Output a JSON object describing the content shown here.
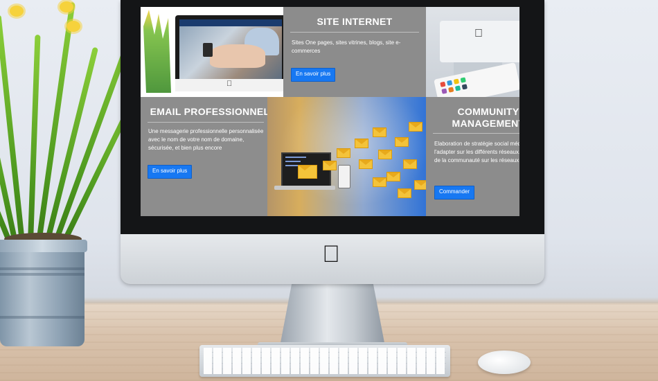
{
  "screen": {
    "tiles": {
      "site": {
        "title": "SITE INTERNET",
        "text": "Sites One pages, sites vitrines, blogs, site e-commerces",
        "button": "En savoir plus"
      },
      "email": {
        "title": "EMAIL PROFESSIONNEL",
        "text": "Une messagerie professionnelle personnalisée avec le nom de votre nom de domaine, sécurisée, et bien plus encore",
        "button": "En savoir plus"
      },
      "community": {
        "title_line1": "COMMUNITY",
        "title_line2": "MANAGEMENT",
        "text": "Elaboration de stratégie social média et l'adapter sur les différents réseaux. Gestion de la communauté sur les réseaux sociaux",
        "button": "Commander"
      }
    }
  },
  "colors": {
    "button_blue": "#1778f2",
    "tile_grey": "#8c8c8c",
    "envelope_yellow": "#f4c33a"
  },
  "icons": {
    "monitor_logo": "apple-logo-icon"
  }
}
